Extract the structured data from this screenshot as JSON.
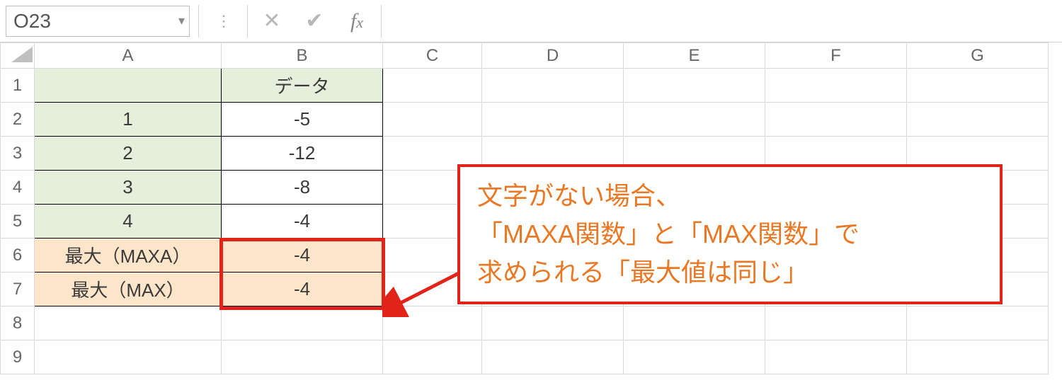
{
  "formula_bar": {
    "name_box_value": "O23",
    "formula_value": ""
  },
  "columns": [
    "A",
    "B",
    "C",
    "D",
    "E",
    "F",
    "G"
  ],
  "row_numbers": [
    "1",
    "2",
    "3",
    "4",
    "5",
    "6",
    "7",
    "8",
    "9"
  ],
  "cells": {
    "A1": "",
    "B1": "データ",
    "A2": "1",
    "B2": "-5",
    "A3": "2",
    "B3": "-12",
    "A4": "3",
    "B4": "-8",
    "A5": "4",
    "B5": "-4",
    "A6": "最大（MAXA）",
    "B6": "-4",
    "A7": "最大（MAX）",
    "B7": "-4"
  },
  "callout": {
    "line1": "文字がない場合、",
    "line2": "「MAXA関数」と「MAX関数」で",
    "line3": "求められる「最大値は同じ」"
  },
  "chart_data": {
    "type": "table",
    "columns": [
      "",
      "データ"
    ],
    "rows": [
      {
        "label": "1",
        "value": -5
      },
      {
        "label": "2",
        "value": -12
      },
      {
        "label": "3",
        "value": -8
      },
      {
        "label": "4",
        "value": -4
      },
      {
        "label": "最大（MAXA）",
        "value": -4
      },
      {
        "label": "最大（MAX）",
        "value": -4
      }
    ]
  }
}
